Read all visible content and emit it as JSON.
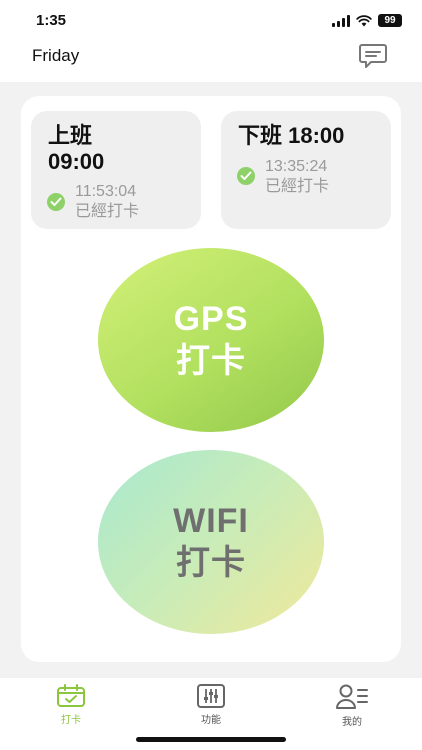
{
  "status_bar": {
    "time": "1:35",
    "battery": "99"
  },
  "header": {
    "title": "Friday"
  },
  "shifts": {
    "on_duty": {
      "title": "上班\n09:00",
      "punch_time": "11:53:04",
      "status": "已經打卡"
    },
    "off_duty": {
      "title": "下班 18:00",
      "punch_time": "13:35:24",
      "status": "已經打卡"
    }
  },
  "buttons": {
    "gps": {
      "line1": "GPS",
      "line2": "打卡"
    },
    "wifi": {
      "line1": "WIFI",
      "line2": "打卡"
    }
  },
  "tabs": [
    {
      "label": "打卡",
      "icon": "calendar-check-icon",
      "active": true
    },
    {
      "label": "功能",
      "icon": "sliders-icon",
      "active": false
    },
    {
      "label": "我的",
      "icon": "user-list-icon",
      "active": false
    }
  ],
  "colors": {
    "accent": "#8cc63f",
    "check": "#8fd169",
    "background": "#f2f2f2"
  }
}
